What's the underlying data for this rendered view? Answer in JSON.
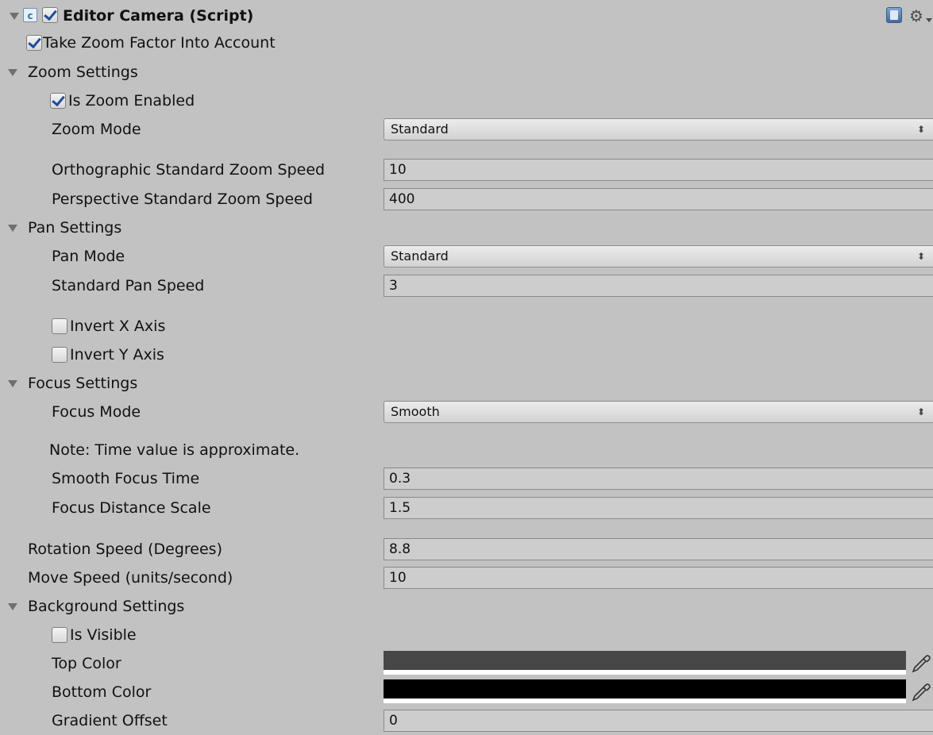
{
  "component": {
    "title": "Editor Camera (Script)",
    "enabled": true,
    "take_zoom_factor": {
      "label": "Take Zoom Factor Into Account",
      "checked": true
    }
  },
  "zoom": {
    "header": "Zoom Settings",
    "is_zoom_enabled": {
      "label": "Is Zoom Enabled",
      "checked": true
    },
    "zoom_mode": {
      "label": "Zoom Mode",
      "value": "Standard"
    },
    "ortho_speed": {
      "label": "Orthographic Standard Zoom Speed",
      "value": "10"
    },
    "persp_speed": {
      "label": "Perspective Standard Zoom Speed",
      "value": "400"
    }
  },
  "pan": {
    "header": "Pan Settings",
    "pan_mode": {
      "label": "Pan Mode",
      "value": "Standard"
    },
    "pan_speed": {
      "label": "Standard Pan Speed",
      "value": "3"
    },
    "invert_x": {
      "label": "Invert X Axis",
      "checked": false
    },
    "invert_y": {
      "label": "Invert Y Axis",
      "checked": false
    }
  },
  "focus": {
    "header": "Focus Settings",
    "focus_mode": {
      "label": "Focus Mode",
      "value": "Smooth"
    },
    "note": "Note: Time value is approximate.",
    "smooth_time": {
      "label": "Smooth Focus Time",
      "value": "0.3"
    },
    "distance_scale": {
      "label": "Focus Distance Scale",
      "value": "1.5"
    }
  },
  "rotation_speed": {
    "label": "Rotation Speed (Degrees)",
    "value": "8.8"
  },
  "move_speed": {
    "label": "Move Speed (units/second)",
    "value": "10"
  },
  "background": {
    "header": "Background Settings",
    "is_visible": {
      "label": "Is Visible",
      "checked": false
    },
    "top_color": {
      "label": "Top Color",
      "color": "#474747"
    },
    "bottom_color": {
      "label": "Bottom Color",
      "color": "#000000"
    },
    "gradient_offset": {
      "label": "Gradient Offset",
      "value": "0"
    }
  },
  "colors": {
    "background": "#c2c2c2",
    "field": "#cdcdcd",
    "check_accent": "#1a4da1",
    "script_icon": "#2d77c9"
  }
}
